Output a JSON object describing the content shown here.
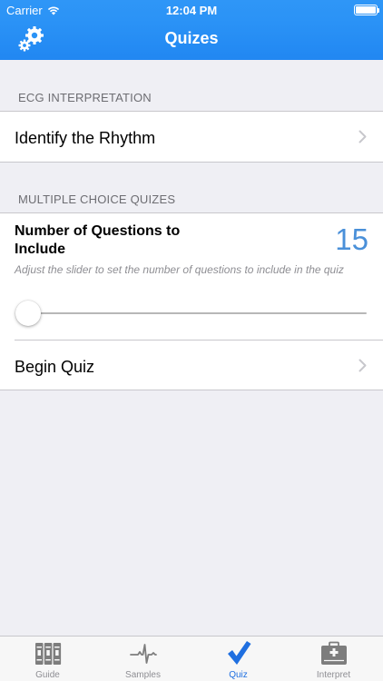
{
  "status_bar": {
    "carrier": "Carrier",
    "time": "12:04 PM"
  },
  "nav": {
    "title": "Quizes",
    "settings_icon": "gears-icon"
  },
  "sections": {
    "ecg": {
      "header": "ECG INTERPRETATION",
      "items": [
        {
          "label": "Identify the Rhythm"
        }
      ]
    },
    "mcq": {
      "header": "MULTIPLE CHOICE QUIZES",
      "question_label": "Number of Questions to Include",
      "question_count": "15",
      "hint": "Adjust the slider to set the number of questions to include in the quiz",
      "slider_level": 0.0,
      "begin_label": "Begin Quiz"
    }
  },
  "tabs": [
    {
      "label": "Guide",
      "icon": "books-icon",
      "active": false
    },
    {
      "label": "Samples",
      "icon": "ecg-wave-icon",
      "active": false
    },
    {
      "label": "Quiz",
      "icon": "checkmark-icon",
      "active": true
    },
    {
      "label": "Interpret",
      "icon": "medical-kit-icon",
      "active": false
    }
  ],
  "colors": {
    "accent": "#2187f2",
    "count": "#4a90d9",
    "background": "#efeff4"
  }
}
